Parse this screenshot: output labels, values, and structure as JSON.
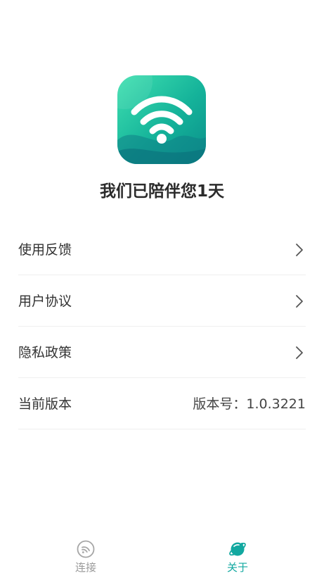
{
  "app": {
    "logo_icon": "wifi-app-icon",
    "headline": "我们已陪伴您1天"
  },
  "menu": {
    "items": [
      {
        "label": "使用反馈",
        "icon": "chevron-right-icon"
      },
      {
        "label": "用户协议",
        "icon": "chevron-right-icon"
      },
      {
        "label": "隐私政策",
        "icon": "chevron-right-icon"
      },
      {
        "label": "当前版本",
        "value": "版本号：1.0.3221"
      }
    ]
  },
  "bottom_nav": {
    "tabs": [
      {
        "label": "连接",
        "icon": "wifi-circle-icon",
        "active": false
      },
      {
        "label": "关于",
        "icon": "planet-icon",
        "active": true
      }
    ]
  },
  "colors": {
    "accent": "#12a8a0",
    "inactive": "#9a9a9a",
    "text": "#333333",
    "divider": "#efefef"
  }
}
